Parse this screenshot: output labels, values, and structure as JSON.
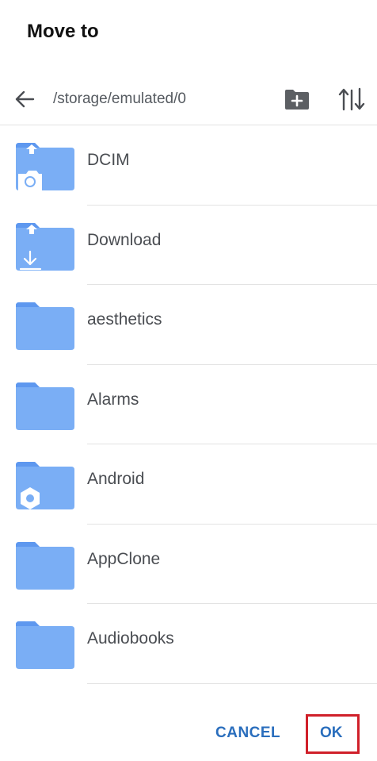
{
  "dialog": {
    "title": "Move to"
  },
  "pathbar": {
    "back_icon": "arrow-left-icon",
    "path": "/storage/emulated/0",
    "new_folder_icon": "create-folder-icon",
    "sort_icon": "sort-icon"
  },
  "folders": [
    {
      "name": "DCIM",
      "icon": "folder-camera-icon"
    },
    {
      "name": "Download",
      "icon": "folder-download-icon"
    },
    {
      "name": "aesthetics",
      "icon": "folder-icon"
    },
    {
      "name": "Alarms",
      "icon": "folder-icon"
    },
    {
      "name": "Android",
      "icon": "folder-settings-icon"
    },
    {
      "name": "AppClone",
      "icon": "folder-icon"
    },
    {
      "name": "Audiobooks",
      "icon": "folder-icon"
    }
  ],
  "actions": {
    "cancel_label": "CANCEL",
    "ok_label": "OK"
  },
  "colors": {
    "folder": "#7aaef5",
    "folder_tab": "#5e98ef",
    "accent": "#2a6ebd",
    "highlight": "#d0202a"
  }
}
